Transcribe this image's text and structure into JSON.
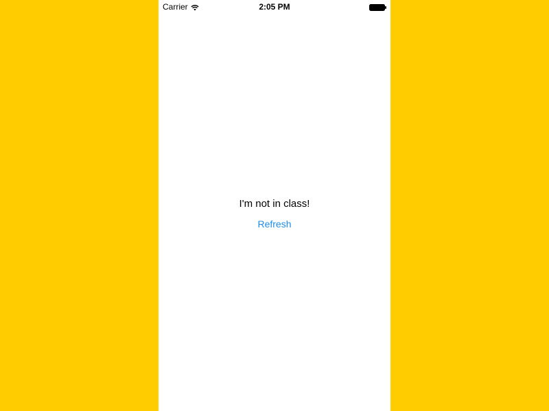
{
  "status_bar": {
    "carrier": "Carrier",
    "time": "2:05 PM",
    "wifi_icon": "wifi-icon",
    "battery_icon": "battery-icon"
  },
  "main": {
    "message": "I'm not in class!",
    "refresh_label": "Refresh"
  },
  "colors": {
    "background": "#FFCC00",
    "screen": "#FFFFFF",
    "accent": "#1E8CE6"
  }
}
